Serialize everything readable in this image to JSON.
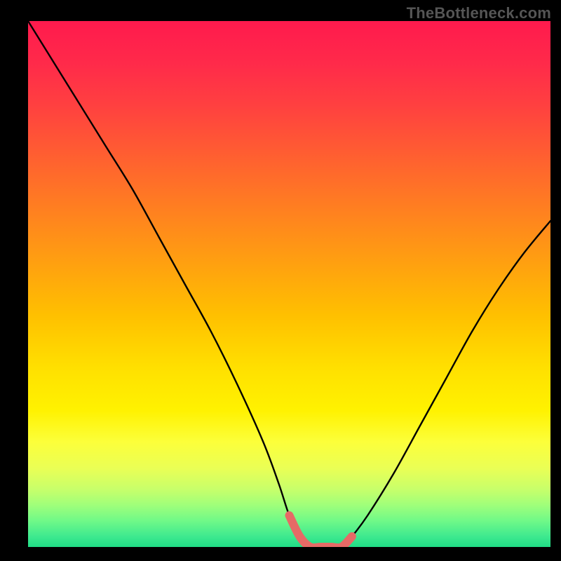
{
  "watermark": "TheBottleneck.com",
  "colors": {
    "curve": "#000000",
    "highlight": "#e66a66",
    "background": "#000000"
  },
  "chart_data": {
    "type": "line",
    "title": "",
    "xlabel": "",
    "ylabel": "",
    "xlim": [
      0,
      100
    ],
    "ylim": [
      0,
      100
    ],
    "grid": false,
    "series": [
      {
        "name": "bottleneck-curve",
        "x": [
          0,
          5,
          10,
          15,
          20,
          25,
          30,
          35,
          40,
          45,
          48,
          50,
          52,
          54,
          56,
          58,
          60,
          62,
          65,
          70,
          75,
          80,
          85,
          90,
          95,
          100
        ],
        "values": [
          100,
          92,
          84,
          76,
          68,
          59,
          50,
          41,
          31,
          20,
          12,
          6,
          2,
          0,
          0,
          0,
          0,
          2,
          6,
          14,
          23,
          32,
          41,
          49,
          56,
          62
        ]
      }
    ],
    "highlight_region": {
      "x": [
        50,
        52,
        54,
        56,
        58,
        60,
        62
      ],
      "values": [
        6,
        2,
        0,
        0,
        0,
        0,
        2
      ]
    },
    "annotations": []
  }
}
